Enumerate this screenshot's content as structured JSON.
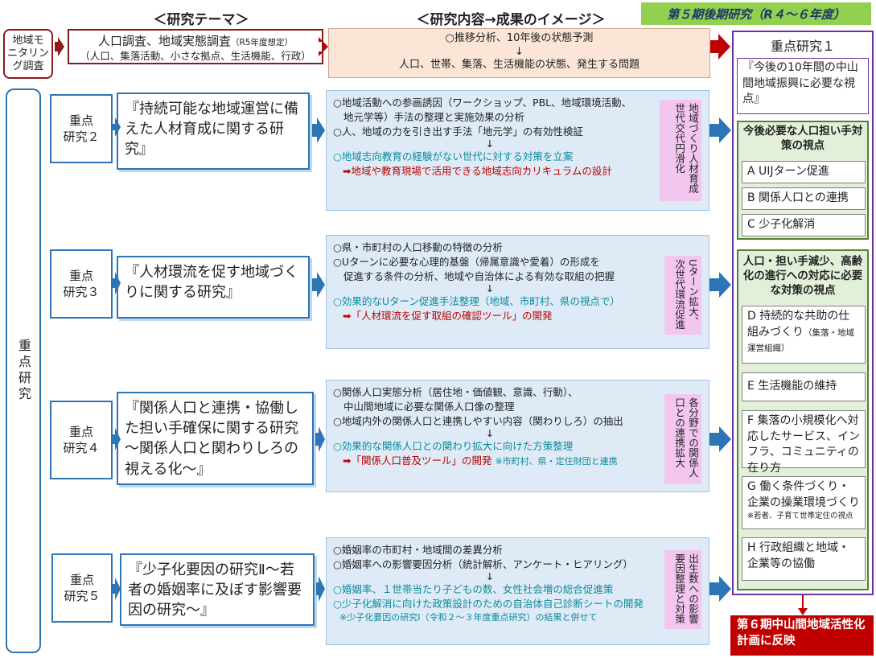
{
  "headers": {
    "theme": "＜研究テーマ＞",
    "content": "＜研究内容→成果のイメージ＞",
    "period": "第５期後期研究（R４～６年度）"
  },
  "monitoring": {
    "label_line1": "地域モ",
    "label_line2": "ニタリン",
    "label_line3": "グ調査",
    "theme_main": "人口調査、地域実態調査",
    "theme_note": "（R5年度想定）",
    "theme_sub": "（人口、集落活動、小さな拠点、生活機能、行政）",
    "content_line1": "○推移分析、10年後の状態予測",
    "content_arrow": "↓",
    "content_line2": "人口、世帯、集落、生活機能の状態、発生する問題"
  },
  "side_label": "重点研究",
  "arrow_down": "↓",
  "research": [
    {
      "label_line1": "重点",
      "label_line2": "研究２",
      "title": "『持続可能な地域運営に備えた人材育成に関する研究』",
      "lines": [
        "○地域活動への参画誘因（ワークショップ、PBL、地域環境活動、",
        "地元学等）手法の整理と実施効果の分析",
        "○人、地域の力を引き出す手法「地元学」の有効性検証"
      ],
      "teal": "○地域志向教育の経験がない世代に対する対策を立案",
      "red": "➡地域や教育現場で活用できる地域志向カリキュラムの設計",
      "note": "",
      "pink": "地域づくり人材育成世代交代円滑化"
    },
    {
      "label_line1": "重点",
      "label_line2": "研究３",
      "title": "『人材環流を促す地域づくりに関する研究』",
      "lines": [
        "○県・市町村の人口移動の特徴の分析",
        "○Uターンに必要な心理的基盤（帰属意識や愛着）の形成を",
        "促進する条件の分析、地域や自治体による有効な取組の把握"
      ],
      "teal": "○効果的なUターン促進手法整理（地域、市町村、県の視点で）",
      "red": "➡「人材環流を促す取組の確認ツール」の開発",
      "note": "",
      "pink": "Uターン拡大、次世代環流促進"
    },
    {
      "label_line1": "重点",
      "label_line2": "研究４",
      "title": "『関係人口と連携・協働した担い手確保に関する研究～関係人口と関わりしろの視える化～』",
      "lines": [
        "○関係人口実態分析（居住地・価値観、意識、行動）、",
        "中山間地域に必要な関係人口像の整理",
        "○地域内外の関係人口と連携しやすい内容（関わりしろ）の抽出"
      ],
      "teal": "○効果的な関係人口との関わり拡大に向けた方策整理",
      "red": "➡「関係人口普及ツール」の開発",
      "note": "※市町村、県・定住財団と連携",
      "pink": "各分野での関係人口との連携拡大"
    },
    {
      "label_line1": "重点",
      "label_line2": "研究５",
      "title": "『少子化要因の研究Ⅱ～若者の婚姻率に及ぼす影響要因の研究～』",
      "lines": [
        "○婚姻率の市町村・地域間の差異分析",
        "○婚姻率への影響要因分析（統計解析、アンケート・ヒアリング）"
      ],
      "teal": "○婚姻率、１世帯当たり子どもの数、女性社会増の総合促進策",
      "teal2": "○少子化解消に向けた政策設計のための自治体自己診断シートの開発",
      "note": "※少子化要因の研究Ⅰ（令和２～３年度重点研究）の結果と併せて",
      "pink": "出生数への影響要因整理と対策"
    }
  ],
  "right_panel": {
    "title": "重点研究１",
    "quote": "『今後の10年間の中山間地域振興に必要な視点』",
    "group1_title": "今後必要な人口担い手対策の視点",
    "group1_items": [
      "A UIJターン促進",
      "B 関係人口との連携",
      "C 少子化解消"
    ],
    "group2_title": "人口・担い手減少、高齢化の進行への対応に必要な対策の視点",
    "group2_items": [
      {
        "text": "D 持続的な共助の仕組みづくり",
        "note": "（集落・地域運営組織）"
      },
      {
        "text": "E 生活機能の維持",
        "note": ""
      },
      {
        "text": "F 集落の小規模化へ対応したサービス、インフラ、コミュニティの在り方",
        "note": ""
      },
      {
        "text": "G 働く条件づくり・企業の操業環境づくり",
        "note": "※若者、子育て世帯定住の視点"
      },
      {
        "text": "H 行政組織と地域・企業等の協働",
        "note": ""
      }
    ],
    "final": "第６期中山間地域活性化計画に反映"
  },
  "colors": {
    "blue": "#2e75b6",
    "dark_red": "#8b1a1a",
    "purple": "#7030a0",
    "green": "#92d050",
    "red": "#c00000",
    "pink": "#f3c6f0",
    "teal": "#0b8a9c"
  }
}
